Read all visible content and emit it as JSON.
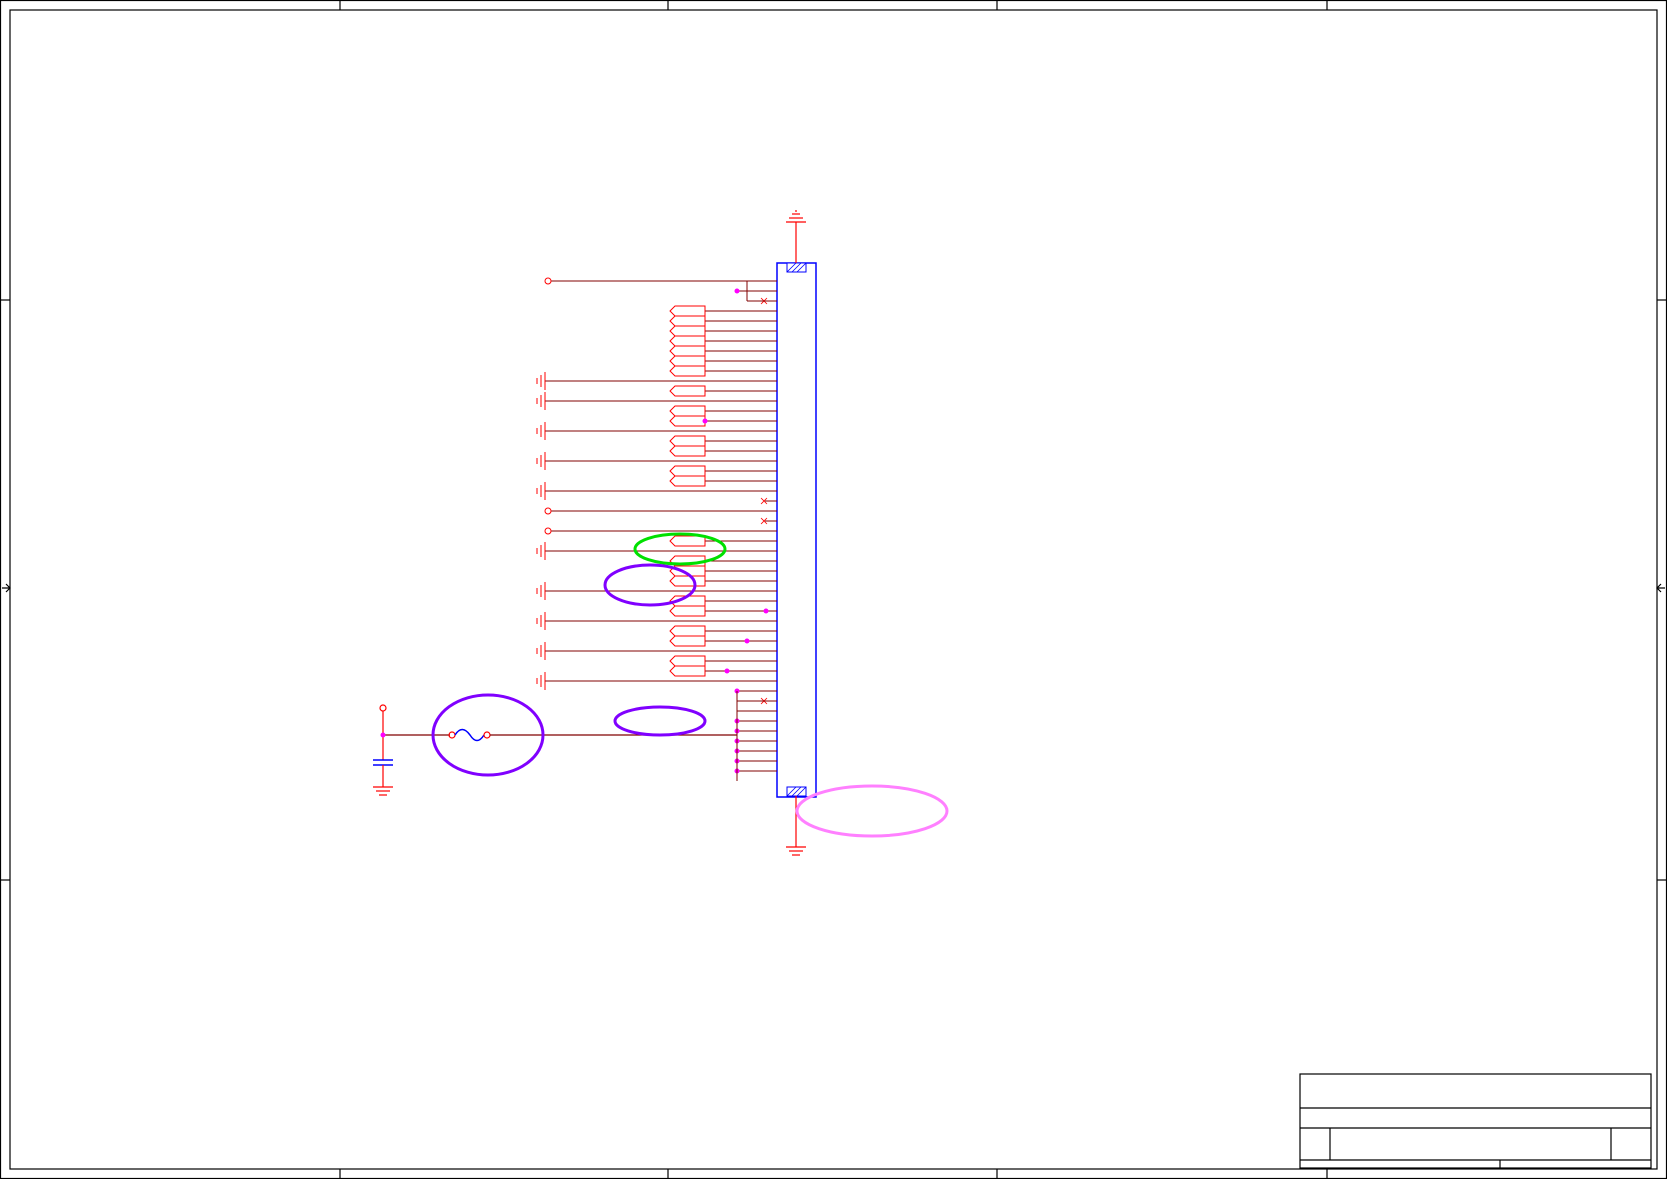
{
  "schematic": {
    "colors": {
      "frame": "#000000",
      "wire": "#800000",
      "symbol": "#ff0000",
      "component_body": "#0000ff",
      "junction": "#ff00ff",
      "circle_violet": "#8000ff",
      "circle_green": "#00e000",
      "circle_pink": "#ff80ff"
    },
    "connector": {
      "pin_count": 50
    },
    "annotations": [
      {
        "color": "green",
        "shape": "ellipse"
      },
      {
        "color": "violet",
        "shape": "ellipse"
      },
      {
        "color": "violet",
        "shape": "ellipse"
      },
      {
        "color": "violet",
        "shape": "ellipse"
      },
      {
        "color": "pink",
        "shape": "ellipse"
      }
    ],
    "title_block": {
      "visible_text": ""
    }
  }
}
